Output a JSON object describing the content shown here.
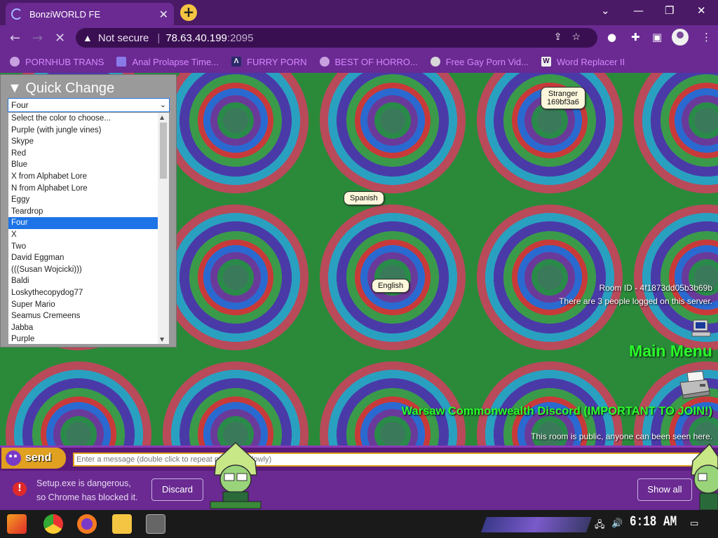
{
  "browser": {
    "tab_title": "BonziWORLD FE",
    "new_tab_label": "+",
    "security_label": "Not secure",
    "url_host": "78.63.40.199",
    "url_port": ":2095",
    "bookmarks": [
      {
        "label": "PORNHUB TRANS",
        "icon": "globe-icon"
      },
      {
        "label": "Anal Prolapse Time...",
        "icon": "bracket-icon"
      },
      {
        "label": "FURRY PORN",
        "icon": "lambda-icon"
      },
      {
        "label": "BEST OF HORRO...",
        "icon": "globe-icon"
      },
      {
        "label": "Free Gay Porn Vid...",
        "icon": "figure-icon"
      },
      {
        "label": "Word Replacer II",
        "icon": "wr-icon"
      }
    ]
  },
  "quick_change": {
    "title": "Quick Change",
    "selected": "Four",
    "options": [
      "Select the color to choose...",
      "Purple (with jungle vines)",
      "Skype",
      "Red",
      "Blue",
      "X from Alphabet Lore",
      "N from Alphabet Lore",
      "Eggy",
      "Teardrop",
      "Four",
      "X",
      "Two",
      "David Eggman",
      "(((Susan Wojcicki)))",
      "Baldi",
      "Loskythecopydog77",
      "Super Mario",
      "Seamus Cremeens",
      "Jabba",
      "Purple"
    ]
  },
  "users": [
    {
      "name": "Stranger",
      "id": "169bf3a6"
    },
    {
      "name": "Spanish"
    },
    {
      "name": "English"
    }
  ],
  "room": {
    "id_text": "Room ID - 4f1873dd05b3b69b",
    "logged_in_text": "There are 3 people logged on this server.",
    "main_menu": "Main Menu",
    "discord_link": "Warsaw Commonwealth Discord (IMPORTANT TO JOIN!)",
    "public_notice": "This room is public, anyone can been seen here."
  },
  "chat": {
    "send_label": "send",
    "input_placeholder": "Enter a message (double click to repeat message slowly)"
  },
  "download": {
    "warning_line1": "Setup.exe is dangerous,",
    "warning_line2": "so Chrome has blocked it.",
    "discard_label": "Discard",
    "show_all_label": "Show all"
  },
  "taskbar": {
    "clock": "6:18 AM"
  },
  "colors": {
    "accent_green": "#2bff2b",
    "chrome_purple": "#6a2a92",
    "send_orange": "#e0a020",
    "selection_blue": "#1e74e6"
  }
}
